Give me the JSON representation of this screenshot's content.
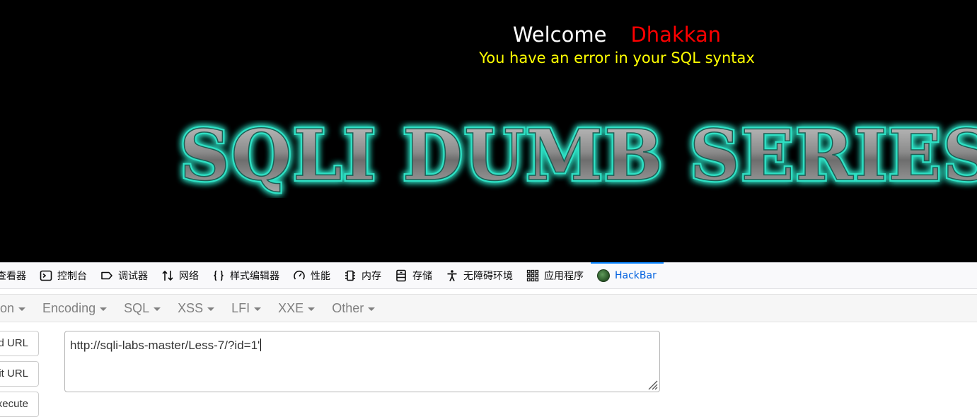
{
  "page": {
    "welcome": "Welcome",
    "name": "Dhakkan",
    "error": "You have an error in your SQL syntax",
    "banner": "SQLI DUMB SERIES"
  },
  "devtools": {
    "tabs": [
      {
        "label": "查看器",
        "icon": "inspector-icon"
      },
      {
        "label": "控制台",
        "icon": "console-icon"
      },
      {
        "label": "调试器",
        "icon": "debugger-icon"
      },
      {
        "label": "网络",
        "icon": "network-icon"
      },
      {
        "label": "样式编辑器",
        "icon": "style-editor-icon"
      },
      {
        "label": "性能",
        "icon": "performance-icon"
      },
      {
        "label": "内存",
        "icon": "memory-icon"
      },
      {
        "label": "存储",
        "icon": "storage-icon"
      },
      {
        "label": "无障碍环境",
        "icon": "accessibility-icon"
      },
      {
        "label": "应用程序",
        "icon": "application-icon"
      },
      {
        "label": "HackBar",
        "icon": "hackbar-icon",
        "active": true
      }
    ]
  },
  "hackbar": {
    "menu": [
      "Injection",
      "Encoding",
      "SQL",
      "XSS",
      "LFI",
      "XXE",
      "Other"
    ],
    "buttons": {
      "load_url": "Load URL",
      "split_url": "Split URL",
      "execute": "Execute"
    },
    "url": "http://sqli-labs-master/Less-7/?id=1'"
  },
  "colors": {
    "page_bg": "#000000",
    "welcome": "#ffffff",
    "name": "#ff0000",
    "error": "#ffff00",
    "banner_glow": "#2de0c4",
    "active_tab": "#0060df"
  }
}
